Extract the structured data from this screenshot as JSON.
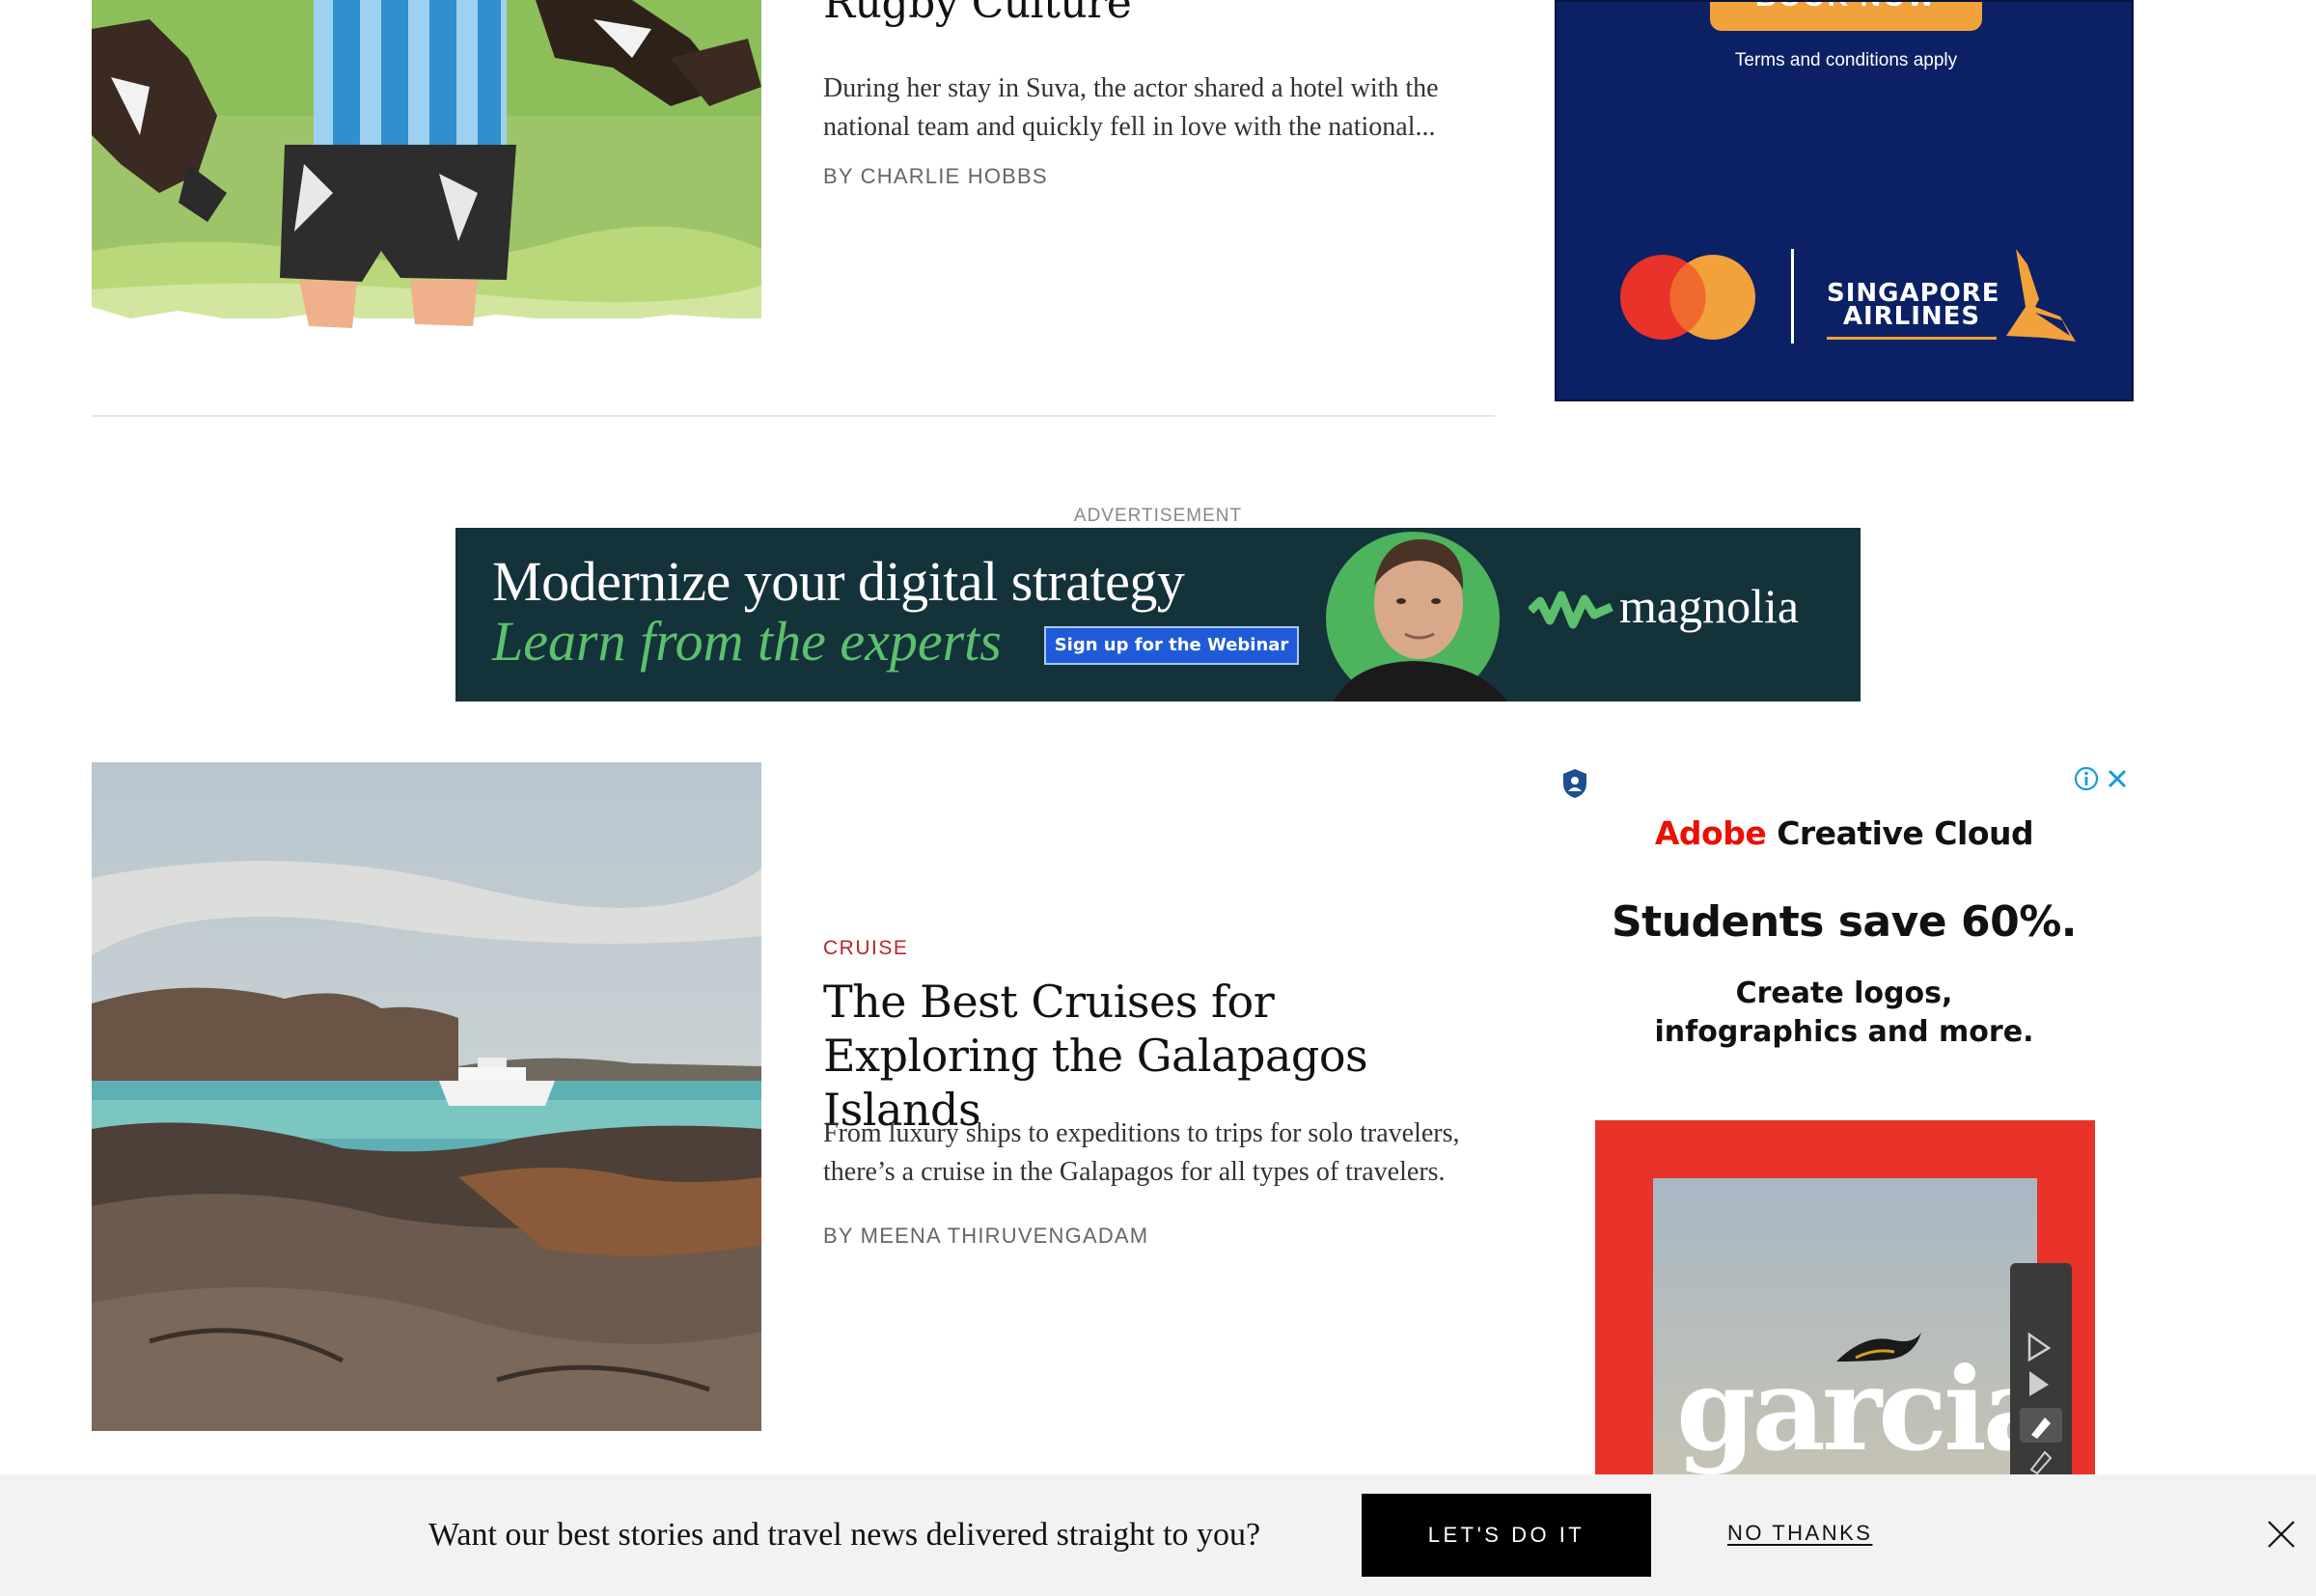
{
  "article_1": {
    "title": "Rugby Culture",
    "description": "During her stay in Suva, the actor shared a hotel with the national team and quickly fell in love with the national...",
    "byline": "BY CHARLIE HOBBS"
  },
  "ad_singapore": {
    "button_label": "BOOK NOW",
    "terms": "Terms and conditions apply",
    "airline_line1": "SINGAPORE",
    "airline_line2": "AIRLINES",
    "background_color": "#0c2066",
    "accent_color": "#f1a23a"
  },
  "advertisement_label": "ADVERTISEMENT",
  "ad_magnolia": {
    "headline": "Modernize your digital strategy",
    "subheadline": "Learn from the experts",
    "button_label": "Sign up for the Webinar",
    "brand": "magnolia",
    "background_color": "#14323a",
    "accent_color": "#5cc06c"
  },
  "article_2": {
    "category": "CRUISE",
    "title": "The Best Cruises for Exploring the Galapagos Islands",
    "description": "From luxury ships to expeditions to trips for solo travelers, there’s a cruise in the Galapagos for all types of travelers.",
    "byline": "BY MEENA THIRUVENGADAM"
  },
  "ad_adobe": {
    "brand_red": "Adobe",
    "brand_rest": " Creative Cloud",
    "headline": "Students save 60%.",
    "subline_1": "Create logos,",
    "subline_2": "infographics and more.",
    "poster_word": "garcia",
    "icons": [
      "adchoices-shield-icon",
      "info-icon",
      "close-icon"
    ]
  },
  "newsletter": {
    "prompt": "Want our best stories and travel news delivered straight to you?",
    "accept_label": "LET'S DO IT",
    "decline_label": "NO THANKS",
    "close_icon": "close-icon"
  }
}
